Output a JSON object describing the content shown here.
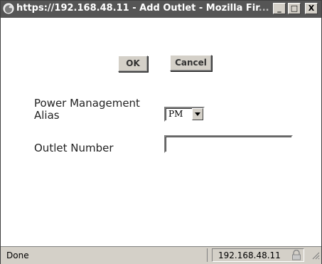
{
  "window": {
    "title_main": "https://192.168.48.11 - Add Outlet - Mozilla Fir",
    "title_fade": "...",
    "controls": {
      "minimize": "_",
      "maximize": "□",
      "close": "X"
    }
  },
  "buttons": {
    "ok": "OK",
    "cancel": "Cancel"
  },
  "form": {
    "alias_label_line1": "Power Management",
    "alias_label_line2": "Alias",
    "alias_value": "PM",
    "outlet_label": "Outlet Number",
    "outlet_value": ""
  },
  "status": {
    "text": "Done",
    "host": "192.168.48.11"
  },
  "icons": {
    "app": "firefox-icon",
    "dropdown": "chevron-down-icon",
    "lock": "lock-icon",
    "grip": "resize-grip-icon"
  }
}
